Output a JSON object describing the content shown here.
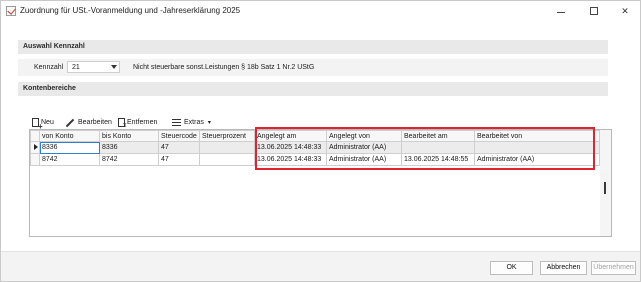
{
  "window": {
    "title": "Zuordnung für USt.-Voranmeldung und -Jahreserklärung 2025"
  },
  "group_auswahl": {
    "title": "Auswahl Kennzahl"
  },
  "kennzahl": {
    "label": "Kennzahl",
    "value": "21",
    "description": "Nicht steuerbare sonst.Leistungen § 18b Satz 1 Nr.2 UStG"
  },
  "group_konten": {
    "title": "Kontenbereiche"
  },
  "toolbar": {
    "neu": "Neu",
    "bearbeiten": "Bearbeiten",
    "entfernen": "Entfernen",
    "extras": "Extras"
  },
  "table": {
    "columns": [
      "von Konto",
      "bis Konto",
      "Steuercode",
      "Steuerprozent",
      "Angelegt am",
      "Angelegt von",
      "Bearbeitet am",
      "Bearbeitet von"
    ],
    "rows": [
      [
        "8336",
        "8336",
        "47",
        "",
        "13.06.2025 14:48:33",
        "Administrator (AA)",
        "",
        ""
      ],
      [
        "8742",
        "8742",
        "47",
        "",
        "13.06.2025 14:48:33",
        "Administrator (AA)",
        "13.06.2025 14:48:55",
        "Administrator (AA)"
      ]
    ]
  },
  "buttons": {
    "ok": "OK",
    "cancel": "Abbrechen",
    "apply": "Übernehmen"
  },
  "colors": {
    "highlight": "#e0242f",
    "selection": "#2d7fd3",
    "header_bg": "#e9e9e9"
  }
}
